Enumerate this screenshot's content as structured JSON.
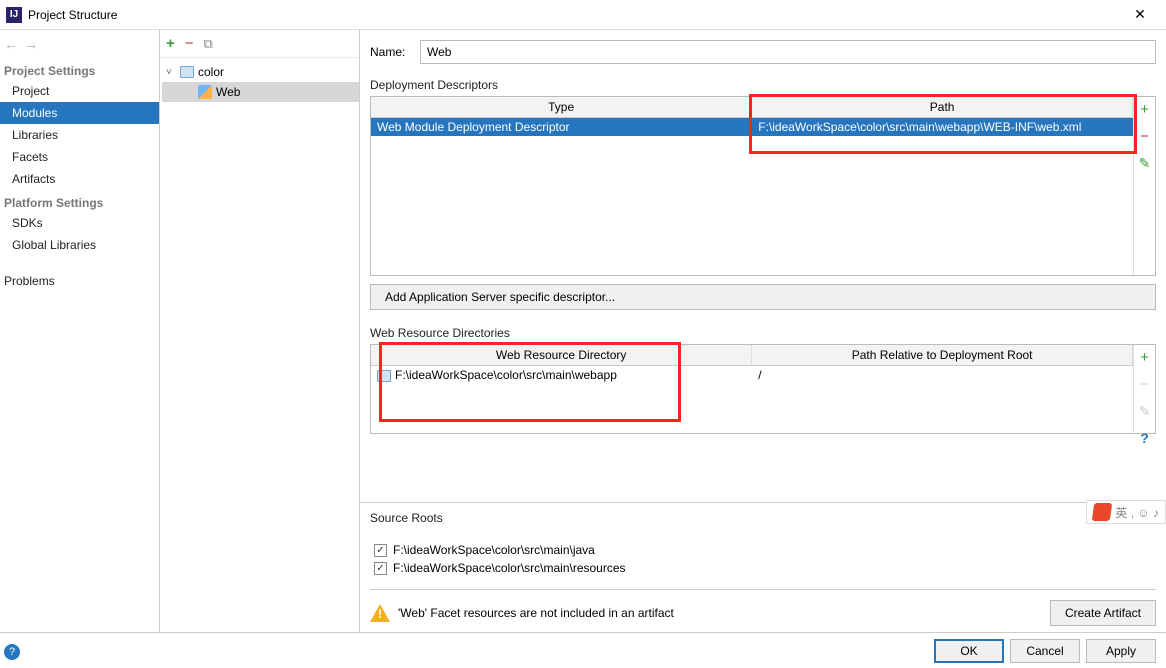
{
  "titlebar": {
    "title": "Project Structure"
  },
  "history": {
    "back": "←",
    "forward": "→"
  },
  "sidebar": {
    "section1": "Project Settings",
    "items1": [
      "Project",
      "Modules",
      "Libraries",
      "Facets",
      "Artifacts"
    ],
    "section2": "Platform Settings",
    "items2": [
      "SDKs",
      "Global Libraries"
    ],
    "problems": "Problems"
  },
  "tree": {
    "root": "color",
    "child": "Web"
  },
  "content": {
    "name_label": "Name:",
    "name_value": "Web",
    "deploy_label": "Deployment Descriptors",
    "deploy_cols": [
      "Type",
      "Path"
    ],
    "deploy_row": {
      "type": "Web Module Deployment Descriptor",
      "path": "F:\\ideaWorkSpace\\color\\src\\main\\webapp\\WEB-INF\\web.xml"
    },
    "add_desc_btn": "Add Application Server specific descriptor...",
    "wrd_label": "Web Resource Directories",
    "wrd_cols": [
      "Web Resource Directory",
      "Path Relative to Deployment Root"
    ],
    "wrd_row": {
      "dir": "F:\\ideaWorkSpace\\color\\src\\main\\webapp",
      "rel": "/"
    },
    "source_roots_label": "Source Roots",
    "source_roots": [
      "F:\\ideaWorkSpace\\color\\src\\main\\java",
      "F:\\ideaWorkSpace\\color\\src\\main\\resources"
    ],
    "warning": "'Web' Facet resources are not included in an artifact",
    "create_artifact": "Create Artifact"
  },
  "footer": {
    "ok": "OK",
    "cancel": "Cancel",
    "apply": "Apply"
  },
  "ime": {
    "text": "英 , ☺ ♪"
  }
}
